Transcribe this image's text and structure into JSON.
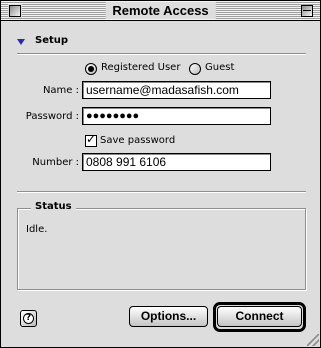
{
  "window": {
    "title": "Remote Access"
  },
  "setup": {
    "label": "Setup",
    "user_type": {
      "options": [
        "Registered User",
        "Guest"
      ],
      "selected": "Registered User"
    },
    "name": {
      "label": "Name :",
      "value": "username@madasafish.com"
    },
    "password": {
      "label": "Password :",
      "value": "●●●●●●●●"
    },
    "save_password": {
      "label": "Save password",
      "checked": true
    },
    "number": {
      "label": "Number :",
      "value": "0808 991 6106"
    }
  },
  "status": {
    "label": "Status",
    "text": "Idle."
  },
  "buttons": {
    "help": "?",
    "options": "Options...",
    "connect": "Connect"
  },
  "icons": {
    "close": "close-box-icon",
    "collapse": "window-collapse-icon",
    "disclosure": "disclosure-triangle-down-icon",
    "help": "help-icon"
  },
  "colors": {
    "window_bg": "#dddddd",
    "disclosure": "#2a2aa8"
  }
}
